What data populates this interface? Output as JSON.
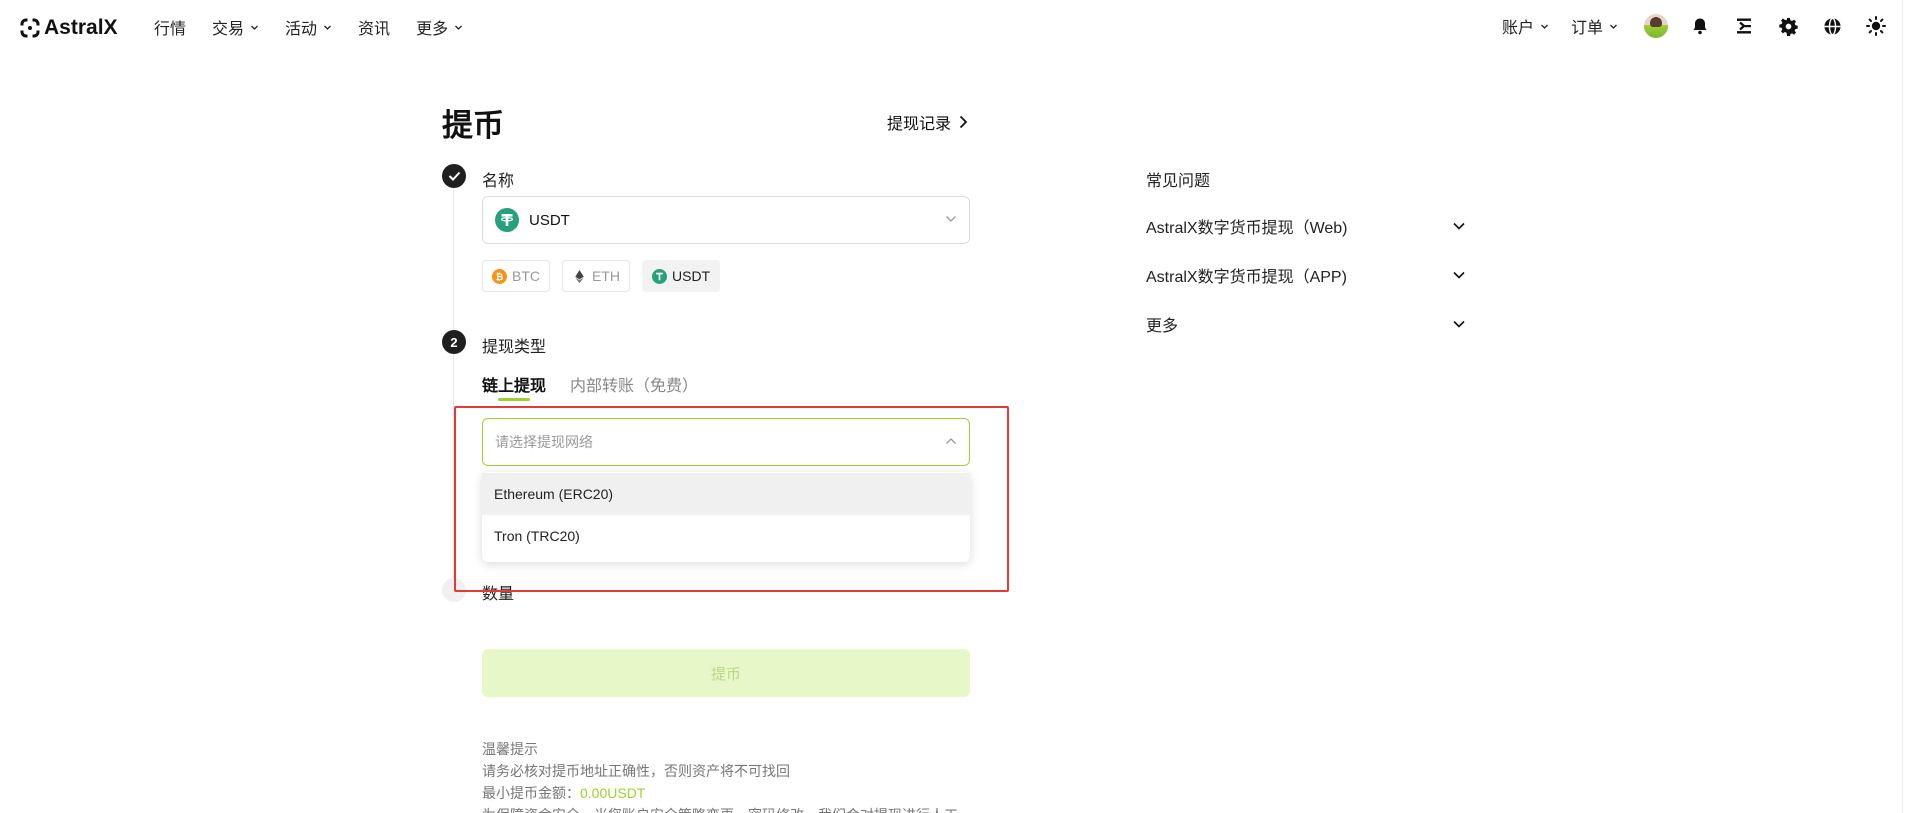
{
  "brand": {
    "name": "AstralX",
    "accent": "#9fd12e"
  },
  "nav": {
    "left": [
      {
        "label": "行情",
        "dropdown": false
      },
      {
        "label": "交易",
        "dropdown": true
      },
      {
        "label": "活动",
        "dropdown": true
      },
      {
        "label": "资讯",
        "dropdown": false
      },
      {
        "label": "更多",
        "dropdown": true
      }
    ],
    "right": [
      {
        "label": "账户",
        "dropdown": true
      },
      {
        "label": "订单",
        "dropdown": true
      }
    ],
    "icons": [
      "avatar",
      "bell-icon",
      "download-icon",
      "gear-icon",
      "globe-icon",
      "theme-sun-icon"
    ]
  },
  "page": {
    "title": "提币",
    "history_link": "提现记录"
  },
  "step1": {
    "label": "名称",
    "selected_coin": "USDT",
    "chips": [
      {
        "label": "BTC",
        "icon": "btc-icon",
        "active": false
      },
      {
        "label": "ETH",
        "icon": "eth-icon",
        "active": false
      },
      {
        "label": "USDT",
        "icon": "usdt-icon",
        "active": true
      }
    ]
  },
  "step2": {
    "number": "2",
    "label": "提现类型",
    "tabs": [
      {
        "label": "链上提现",
        "active": true
      },
      {
        "label": "内部转账（免费）",
        "active": false
      }
    ],
    "network_placeholder": "请选择提现网络",
    "network_options": [
      "Ethereum (ERC20)",
      "Tron (TRC20)"
    ]
  },
  "step3": {
    "label": "数量"
  },
  "submit_label": "提币",
  "notes": {
    "title": "温馨提示",
    "line1": "请务必核对提币地址正确性，否则资产将不可找回",
    "min_label": "最小提币金额：",
    "min_value": "0.00USDT",
    "line3": "为保障资金安全，当您账户安全策略变更、密码修改，我们会对提现进行人工"
  },
  "faq": {
    "title": "常见问题",
    "items": [
      "AstralX数字货币提现（Web)",
      "AstralX数字货币提现（APP)",
      "更多"
    ]
  }
}
